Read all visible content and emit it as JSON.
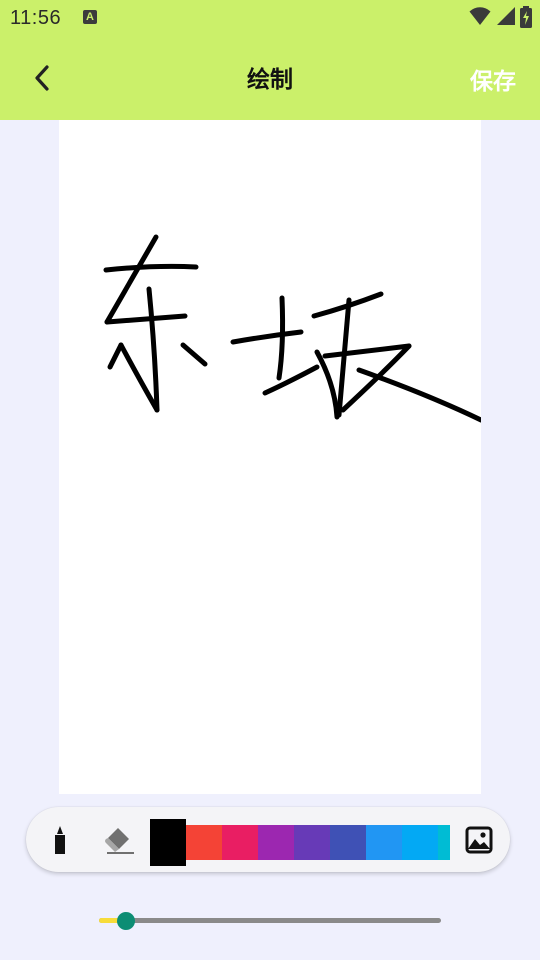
{
  "status_bar": {
    "time": "11:56",
    "app_indicator": "A",
    "icons": [
      "wifi-icon",
      "cell-signal-icon",
      "battery-charging-icon"
    ]
  },
  "app_bar": {
    "title": "绘制",
    "save_label": "保存",
    "back_icon": "chevron-left-icon",
    "background": "#cbf06a"
  },
  "canvas": {
    "drawn_text": "东坡",
    "stroke_color": "#000000"
  },
  "toolbar": {
    "tools": [
      "pen-icon",
      "eraser-icon",
      "image-icon"
    ],
    "palette": [
      "#000000",
      "#f44336",
      "#e91e63",
      "#9c27b0",
      "#673ab7",
      "#3f51b5",
      "#2196f3",
      "#03a9f4",
      "#00bcd4"
    ],
    "selected_color": "#000000"
  },
  "brush_size": {
    "fraction": 0.08,
    "fill_color": "#f7dc3a",
    "thumb_color": "#0c8d74"
  }
}
